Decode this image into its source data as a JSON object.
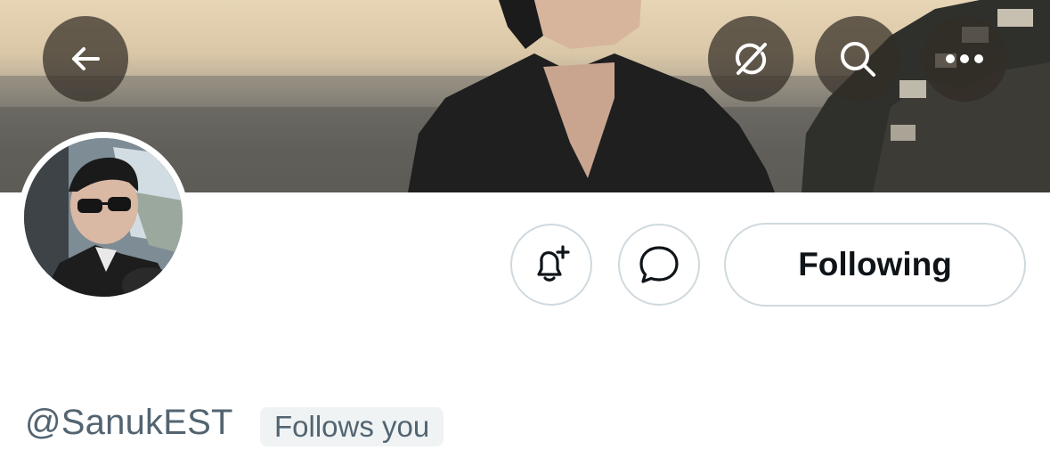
{
  "header": {
    "back_icon": "arrow-left-icon",
    "grok_icon": "grok-icon",
    "search_icon": "search-icon",
    "more_icon": "more-horizontal-icon"
  },
  "profile": {
    "handle": "@SanukEST",
    "follows_you_label": "Follows you"
  },
  "actions": {
    "notify_icon": "bell-plus-icon",
    "message_icon": "message-bubble-icon",
    "following_label": "Following"
  },
  "colors": {
    "text_primary": "#0f1419",
    "text_secondary": "#536471",
    "border": "#cfd9de",
    "badge_bg": "#eff3f4"
  }
}
